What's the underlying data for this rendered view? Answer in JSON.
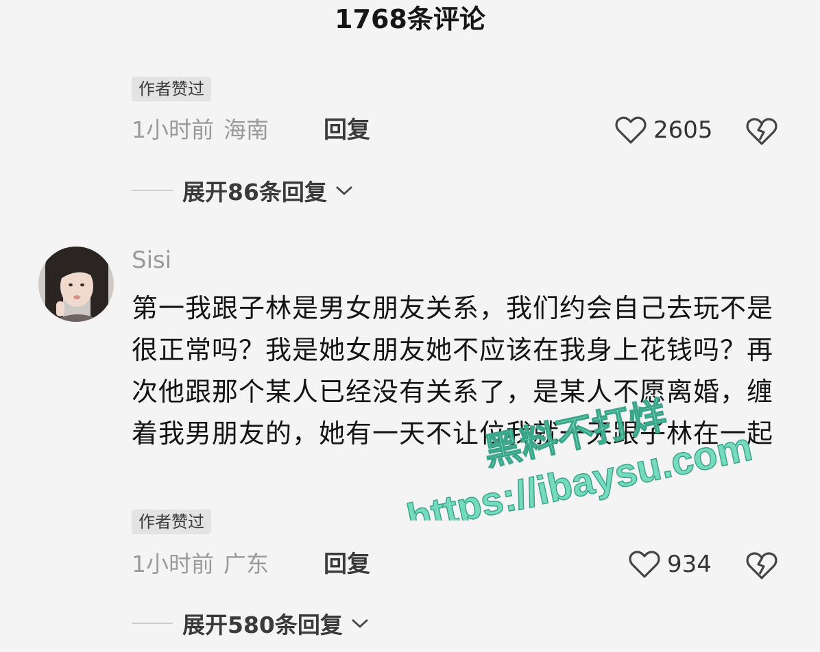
{
  "header": {
    "title": "1768条评论"
  },
  "comment_prev": {
    "badge": "作者赞过",
    "time": "1小时前",
    "location": "海南",
    "reply_label": "回复",
    "like_count": "2605",
    "expand_label": "展开86条回复"
  },
  "comment_sisi": {
    "username": "Sisi",
    "text": "第一我跟子林是男女朋友关系，我们约会自己去玩不是很正常吗？我是她女朋友她不应该在我身上花钱吗？再次他跟那个某人已经没有关系了，是某人不愿离婚，缠着我男朋友的，她有一天不让位我就一天跟子林在一起",
    "badge": "作者赞过",
    "time": "1小时前",
    "location": "广东",
    "reply_label": "回复",
    "like_count": "934",
    "expand_label": "展开580条回复"
  },
  "watermark": {
    "line1": "黑料不打烊",
    "line2": "https://ibaysu.com",
    "color": "#5fd6b4"
  },
  "colors": {
    "background": "#f4f4f4",
    "meta_text": "#9a9a9a",
    "badge_bg": "#e3e3e3"
  },
  "icons": {
    "like": "heart-outline-icon",
    "dislike": "broken-heart-icon",
    "expand": "chevron-down-icon"
  }
}
